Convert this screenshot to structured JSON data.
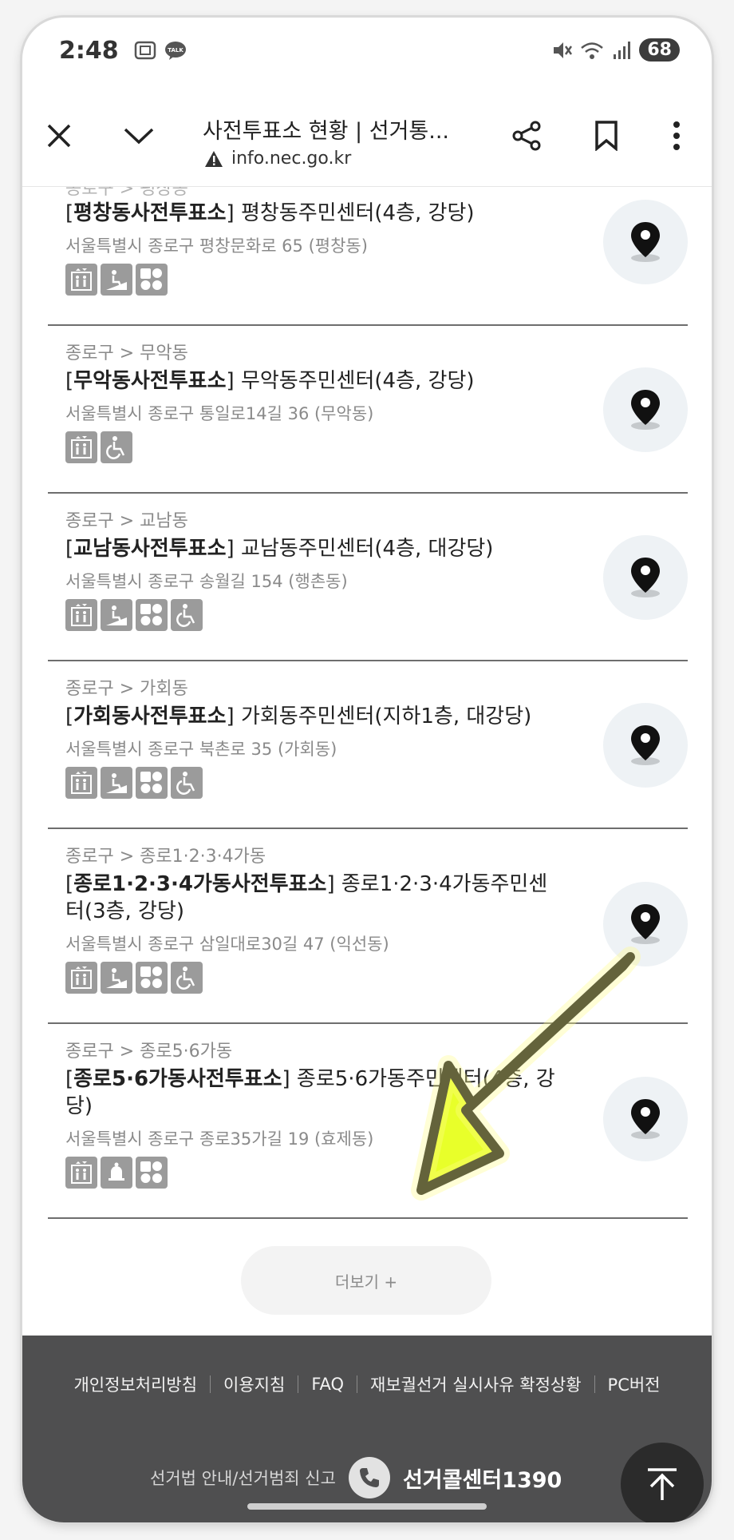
{
  "status": {
    "time": "2:48",
    "talk_badge": "TALK",
    "battery": "68"
  },
  "browser": {
    "title": "사전투표소 현황 | 선거통...",
    "url": "info.nec.go.kr"
  },
  "top_crumb_partial": "종로구 > 평창동",
  "items": [
    {
      "crumb": "",
      "bold": "평창동사전투표소",
      "place": " 평창동주민센터(4층, 강당)",
      "address": "서울특별시 종로구 평창문화로 65 (평창동)",
      "facilities": [
        "elevator-icon",
        "ramp-icon",
        "braille-icon"
      ]
    },
    {
      "crumb": "종로구 > 무악동",
      "bold": "무악동사전투표소",
      "place": " 무악동주민센터(4층, 강당)",
      "address": "서울특별시 종로구 통일로14길 36 (무악동)",
      "facilities": [
        "elevator-icon",
        "wheelchair-icon"
      ]
    },
    {
      "crumb": "종로구 > 교남동",
      "bold": "교남동사전투표소",
      "place": " 교남동주민센터(4층, 대강당)",
      "address": "서울특별시 종로구 송월길 154 (행촌동)",
      "facilities": [
        "elevator-icon",
        "ramp-icon",
        "braille-icon",
        "wheelchair-icon"
      ]
    },
    {
      "crumb": "종로구 > 가회동",
      "bold": "가회동사전투표소",
      "place": " 가회동주민센터(지하1층, 대강당)",
      "address": "서울특별시 종로구 북촌로 35 (가회동)",
      "facilities": [
        "elevator-icon",
        "ramp-icon",
        "braille-icon",
        "wheelchair-icon"
      ]
    },
    {
      "crumb": "종로구 > 종로1·2·3·4가동",
      "bold": "종로1·2·3·4가동사전투표소",
      "place": " 종로1·2·3·4가동주민센터(3층, 강당)",
      "address": "서울특별시 종로구 삼일대로30길 47 (익선동)",
      "facilities": [
        "elevator-icon",
        "ramp-icon",
        "braille-icon",
        "wheelchair-icon"
      ]
    },
    {
      "crumb": "종로구 > 종로5·6가동",
      "bold": "종로5·6가동사전투표소",
      "place": " 종로5·6가동주민센터(4층, 강당)",
      "address": "서울특별시 종로구 종로35가길 19 (효제동)",
      "facilities": [
        "elevator-icon",
        "bell-icon",
        "braille-icon"
      ]
    }
  ],
  "more_button": {
    "label": "더보기 +"
  },
  "footer": {
    "links": [
      "개인정보처리방침",
      "이용지침",
      "FAQ",
      "재보궐선거 실시사유 확정상황",
      "PC버전"
    ],
    "law": "선거법 안내/선거범죄 신고",
    "callcenter": "선거콜센터1390"
  },
  "colors": {
    "accent_arrow": "#e8ff2a",
    "footer_bg": "#4f4f50"
  }
}
